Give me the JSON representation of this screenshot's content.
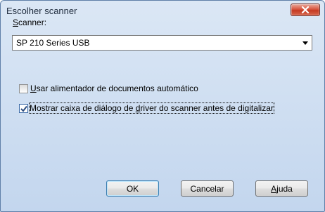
{
  "window": {
    "title": "Escolher scanner"
  },
  "scanner": {
    "label_first": "S",
    "label_rest": "canner:",
    "selected": "SP 210 Series USB"
  },
  "options": {
    "feeder": {
      "label_first": "U",
      "label_rest": "sar alimentador de documentos automático",
      "checked": false
    },
    "show_driver_dialog": {
      "label_pre": "Mostrar caixa de diálogo de ",
      "label_ul": "d",
      "label_post": "river do scanner antes de digitalizar",
      "checked": true
    }
  },
  "buttons": {
    "ok": "OK",
    "cancel": "Cancelar",
    "help_first": "A",
    "help_rest": "juda"
  },
  "icons": {
    "close": "close-icon",
    "dropdown": "chevron-down-icon",
    "check": "checkmark-icon"
  }
}
